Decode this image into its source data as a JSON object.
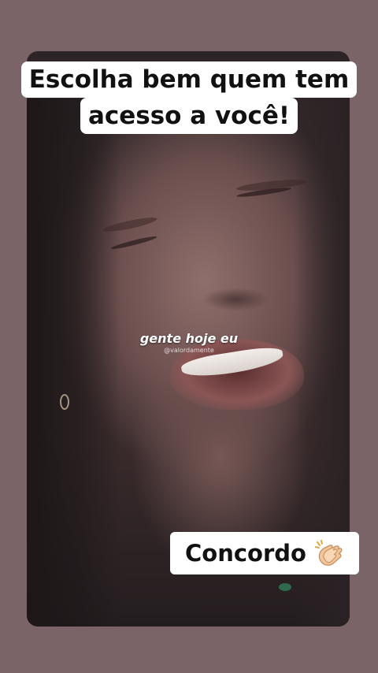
{
  "caption": {
    "line1": "Escolha bem quem tem",
    "line2": "acesso a você!"
  },
  "video": {
    "subtitle": "gente hoje eu",
    "watermark": "@valordamente"
  },
  "sticker": {
    "label": "Concordo",
    "icon": "clapping-hands-icon"
  },
  "colors": {
    "background": "#7b6468",
    "caption_bg": "#ffffff",
    "caption_text": "#111111"
  }
}
